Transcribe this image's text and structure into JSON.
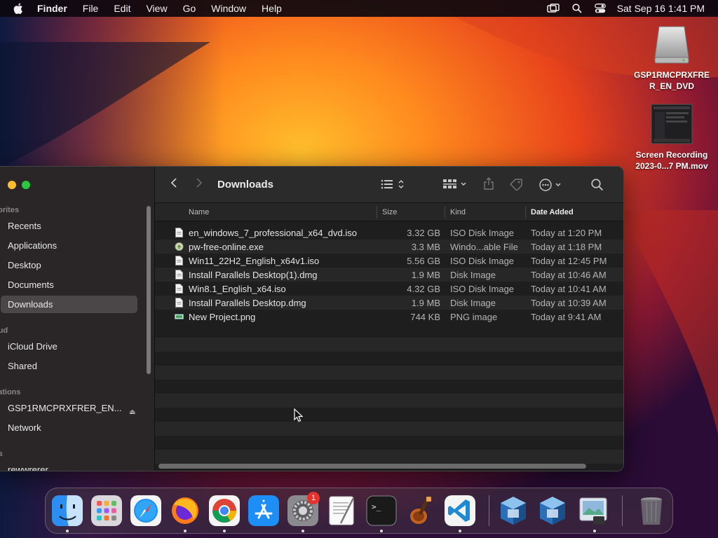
{
  "menubar": {
    "app_name": "Finder",
    "menus": [
      "File",
      "Edit",
      "View",
      "Go",
      "Window",
      "Help"
    ],
    "clock": "Sat Sep 16  1:41 PM"
  },
  "desktop_icons": [
    {
      "label": "GSP1RMCPRXFRE\nR_EN_DVD",
      "icon": "optical-disk-icon"
    },
    {
      "label": "Screen Recording\n2023-0...7 PM.mov",
      "icon": "video-thumbnail-icon"
    }
  ],
  "finder": {
    "title": "Downloads",
    "sidebar": {
      "sections": [
        {
          "label": "vorites",
          "items": [
            "Recents",
            "Applications",
            "Desktop",
            "Documents",
            "Downloads"
          ]
        },
        {
          "label": "oud",
          "items": [
            "iCloud Drive",
            "Shared"
          ]
        },
        {
          "label": "cations",
          "items": [
            "GSP1RMCPRXFRER_EN...",
            "Network"
          ]
        },
        {
          "label": "gs",
          "items": [
            "rewwrerer"
          ]
        }
      ],
      "selected": "Downloads"
    },
    "columns": {
      "name": "Name",
      "size": "Size",
      "kind": "Kind",
      "date": "Date Added"
    },
    "files": [
      {
        "name": "en_windows_7_professional_x64_dvd.iso",
        "size": "3.32 GB",
        "kind": "ISO Disk Image",
        "date": "Today at 1:20 PM",
        "icon": "document-icon"
      },
      {
        "name": "pw-free-online.exe",
        "size": "3.3 MB",
        "kind": "Windo...able File",
        "date": "Today at 1:18 PM",
        "icon": "executable-icon"
      },
      {
        "name": "Win11_22H2_English_x64v1.iso",
        "size": "5.56 GB",
        "kind": "ISO Disk Image",
        "date": "Today at 12:45 PM",
        "icon": "document-icon"
      },
      {
        "name": "Install Parallels Desktop(1).dmg",
        "size": "1.9 MB",
        "kind": "Disk Image",
        "date": "Today at 10:46 AM",
        "icon": "document-icon"
      },
      {
        "name": "Win8.1_English_x64.iso",
        "size": "4.32 GB",
        "kind": "ISO Disk Image",
        "date": "Today at 10:41 AM",
        "icon": "document-icon"
      },
      {
        "name": "Install Parallels Desktop.dmg",
        "size": "1.9 MB",
        "kind": "Disk Image",
        "date": "Today at 10:39 AM",
        "icon": "document-icon"
      },
      {
        "name": "New Project.png",
        "size": "744 KB",
        "kind": "PNG image",
        "date": "Today at 9:41 AM",
        "icon": "image-file-icon"
      }
    ]
  },
  "dock": {
    "apps": [
      "finder-icon",
      "launchpad-icon",
      "safari-icon",
      "firefox-icon",
      "chrome-icon",
      "app-store-icon",
      "system-settings-icon",
      "textedit-icon",
      "terminal-icon",
      "garageband-icon",
      "vscode-icon",
      "virtualbox-icon",
      "virtualbox-icon",
      "preview-icon",
      "trash-icon"
    ],
    "settings_badge": "1"
  },
  "colors": {
    "accent": "#0a84ff",
    "close": "#ff5f57",
    "minimize": "#febc2e",
    "zoom": "#28c840"
  }
}
